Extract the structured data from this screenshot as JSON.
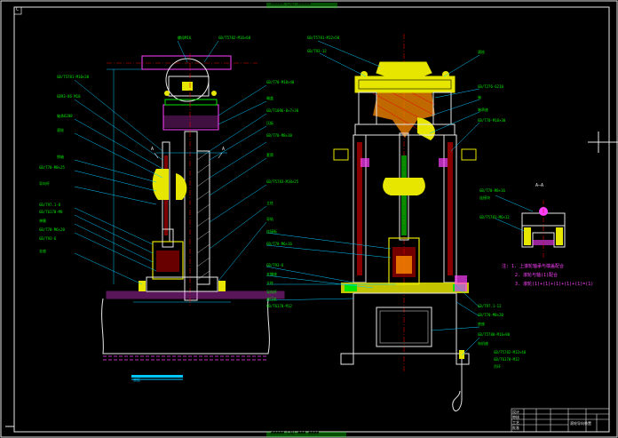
{
  "drawing": {
    "top_title": "##### CAD #####",
    "bottom_title": "##### CAD ### ####",
    "zone_letter": "C",
    "section_label": "A—A",
    "section_marks": [
      "A",
      "A"
    ],
    "notes": [
      "注: 1. 上滚轮轴承与端盖配合",
      "2. 滚轮与轴(1)配合",
      "3. 滚轮(1)+(1)+(1)+(1)+(1)=(1)"
    ]
  },
  "left_view_labels": [
    "GB/T5781-M10×30",
    "GB93-86 M10",
    "轴承6208",
    "滚轮",
    "销轴",
    "GB/T70-M8×25",
    "导向杆",
    "GB/T97.1-8",
    "GB/T6170-M8",
    "弹簧",
    "GB/T70-M6×20",
    "GB/T93-6",
    "支座",
    "螺母M16",
    "GB/T5782-M16×60",
    "底板"
  ],
  "middle_labels": [
    "GB/T70-M10×40",
    "端盖",
    "GB/T1096-8×7×30",
    "压板",
    "GB/T70-M8×30",
    "套筒",
    "GB/T5783-M10×25",
    "立柱",
    "导轨",
    "连接板",
    "GB/T70-M6×16",
    "GB/T93-6",
    "支撑座"
  ],
  "right_view_labels": [
    "GB/T5781-M12×50",
    "GB/T93-12",
    "滚轮",
    "GB/T276-6210",
    "轴",
    "轴承座",
    "GB/T70-M10×30",
    "立柱",
    "导向杆",
    "液压缸",
    "GB/T6170-M12",
    "GB/T97.1-12",
    "GB/T70-M8×20",
    "底座",
    "GB/T5780-M16×80",
    "电机座",
    "GB/T5782-M12×40",
    "GB/T6170-M12",
    "吊环"
  ],
  "section_labels": [
    "GB/T70-M8×16",
    "连接块",
    "GB/T5783-M6×12"
  ],
  "title_block": {
    "rows": [
      "设计",
      "审核",
      "工艺",
      "批准"
    ],
    "name": "滚轮导向装置"
  }
}
